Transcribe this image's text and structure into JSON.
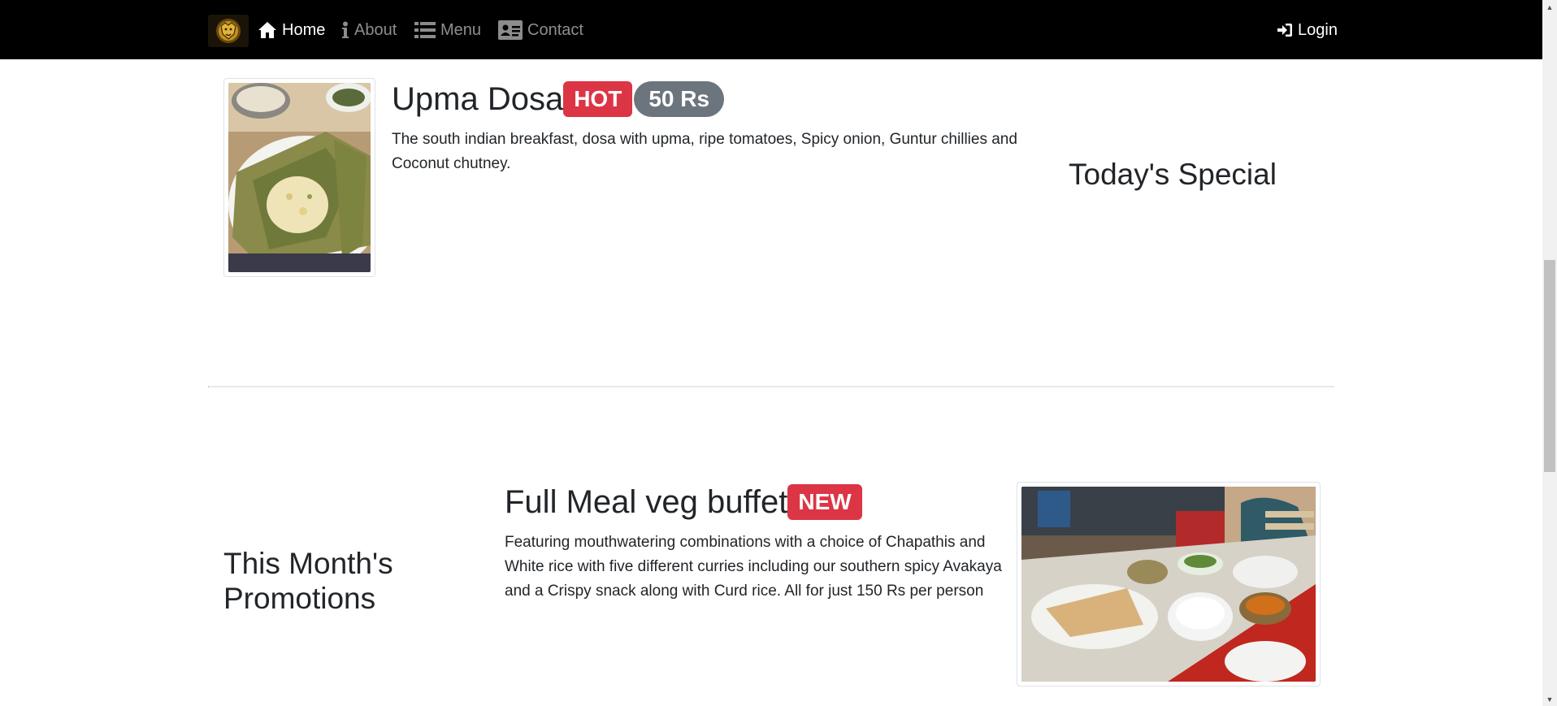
{
  "nav": {
    "brand_logo": "lion-crest-logo",
    "links": [
      {
        "label": "Home",
        "icon": "home-icon",
        "active": true
      },
      {
        "label": "About",
        "icon": "info-icon",
        "active": false
      },
      {
        "label": "Menu",
        "icon": "list-icon",
        "active": false
      },
      {
        "label": "Contact",
        "icon": "contact-card-icon",
        "active": false
      }
    ],
    "login": {
      "label": "Login",
      "icon": "login-icon"
    }
  },
  "todays_special": {
    "heading": "Today's Special",
    "dish": {
      "name": "Upma Dosa",
      "badge": "HOT",
      "price": "50 Rs",
      "description": "The south indian breakfast, dosa with upma, ripe tomatoes, Spicy onion, Guntur chillies and Coconut chutney."
    }
  },
  "promotions": {
    "heading": "This Month's Promotions",
    "dish": {
      "name": "Full Meal veg buffet",
      "badge": "NEW",
      "description": "Featuring mouthwatering combinations with a choice of Chapathis and White rice with five different curries including our southern spicy Avakaya and a Crispy snack along with Curd rice. All for just 150 Rs per person"
    }
  },
  "colors": {
    "navbar_bg": "#000000",
    "badge_red": "#dc3545",
    "badge_gray": "#6c757d",
    "text": "#212529"
  }
}
